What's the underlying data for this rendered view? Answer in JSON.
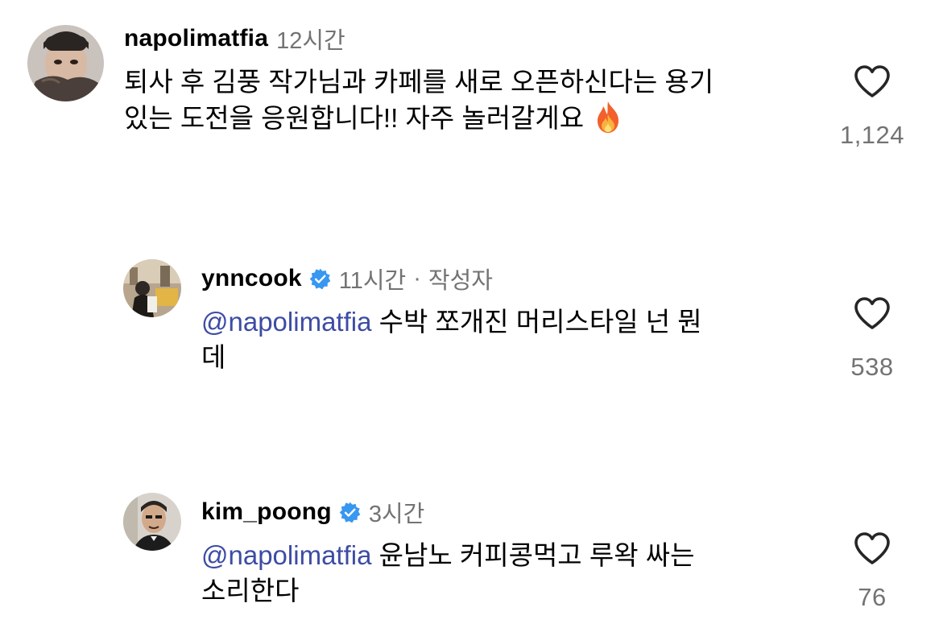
{
  "comments": [
    {
      "username": "napolimatfia",
      "time": "12시간",
      "text_lines": [
        "퇴사 후 김풍 작가님과 카페를 새로 오픈하신다는 용기",
        "있는 도전을 응원합니다!! 자주 놀러갈게요"
      ],
      "emoji_icon": "fire-emoji-icon",
      "likes": "1,124"
    },
    {
      "username": "ynncook",
      "verified": true,
      "time": "11시간",
      "separator": "·",
      "author_tag": "작성자",
      "mention": "@napolimatfia",
      "text_line1": " 수박 쪼개진 머리스타일 넌 뭔",
      "text_line2": "데",
      "likes": "538"
    },
    {
      "username": "kim_poong",
      "verified": true,
      "time": "3시간",
      "mention": "@napolimatfia",
      "text_line1": " 윤남노 커피콩먹고 루왁 싸는",
      "text_line2": "소리한다",
      "likes": "76"
    }
  ],
  "colors": {
    "mention": "#3d4ca3",
    "secondary_text": "#737373",
    "verified_badge": "#3897f0"
  }
}
